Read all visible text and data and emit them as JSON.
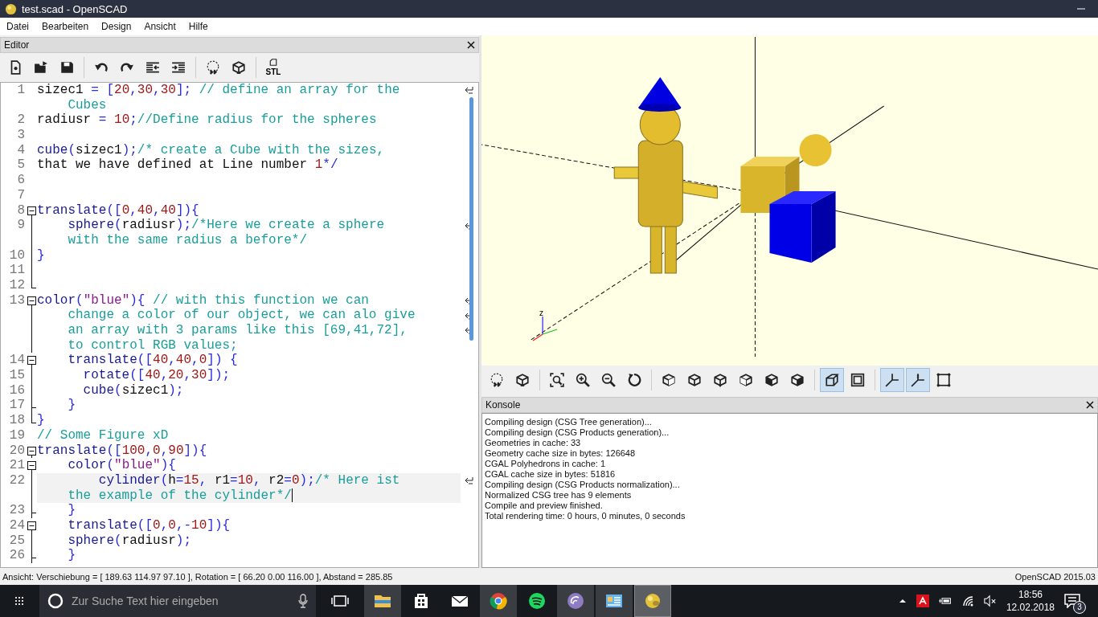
{
  "window": {
    "title": "test.scad - OpenSCAD"
  },
  "menu": [
    "Datei",
    "Bearbeiten",
    "Design",
    "Ansicht",
    "Hilfe"
  ],
  "editor": {
    "title": "Editor",
    "toolbar": [
      [
        {
          "kind": "new"
        },
        {
          "kind": "open"
        },
        {
          "kind": "save"
        }
      ],
      [
        {
          "kind": "undo"
        },
        {
          "kind": "redo"
        },
        {
          "kind": "unindent"
        },
        {
          "kind": "indent"
        }
      ],
      [
        {
          "kind": "preview"
        },
        {
          "kind": "render"
        }
      ],
      [
        {
          "kind": "stl",
          "label": "STL"
        }
      ]
    ],
    "lines": [
      {
        "number": "1",
        "kind": "plain",
        "current": false,
        "rows": [
          "sizec1 = [20,30,30]; // define an array for the",
          "    Cubes"
        ]
      },
      {
        "number": "2",
        "kind": "plain",
        "current": false,
        "rows": [
          "radiusr = 10;//Define radius for the spheres"
        ]
      },
      {
        "number": "3",
        "kind": "plain",
        "current": false
      },
      {
        "number": "4",
        "kind": "plain",
        "current": false,
        "rows": [
          "cube(sizec1);/* create a Cube with the sizes,"
        ]
      },
      {
        "number": "5",
        "kind": "plain",
        "current": false,
        "rows": [
          "that we have defined at Line number 1*/"
        ]
      },
      {
        "number": "6",
        "kind": "plain",
        "current": false
      },
      {
        "number": "7",
        "kind": "plain",
        "current": false
      },
      {
        "number": "8",
        "kind": "open",
        "current": false,
        "rows": [
          "translate([0,40,40]){"
        ]
      },
      {
        "number": "9",
        "kind": "line",
        "current": false,
        "rows": [
          "    sphere(radiusr);/*Here we create a sphere",
          "    with the same radius a before*/"
        ]
      },
      {
        "number": "10",
        "kind": "line",
        "current": false,
        "rows": [
          "}"
        ]
      },
      {
        "number": "11",
        "kind": "line",
        "current": false
      },
      {
        "number": "12",
        "kind": "end",
        "current": false
      },
      {
        "number": "13",
        "kind": "open",
        "current": false,
        "rows": [
          "color(\"blue\"){ // with this function we can",
          "    change a color of our object, we can alo give",
          "    an array with 3 params like this [69,41,72],",
          "    to control RGB values;"
        ]
      },
      {
        "number": "14",
        "kind": "open",
        "current": false,
        "rows": [
          "    translate([40,40,0]) {"
        ]
      },
      {
        "number": "15",
        "kind": "line",
        "current": false,
        "rows": [
          "      rotate([40,20,30]);"
        ]
      },
      {
        "number": "16",
        "kind": "line",
        "current": false,
        "rows": [
          "      cube(sizec1);"
        ]
      },
      {
        "number": "17",
        "kind": "tick",
        "current": false,
        "rows": [
          "    }"
        ]
      },
      {
        "number": "18",
        "kind": "end",
        "current": false,
        "rows": [
          "}"
        ]
      },
      {
        "number": "19",
        "kind": "plain",
        "current": false,
        "rows": [
          "// Some Figure xD"
        ]
      },
      {
        "number": "20",
        "kind": "open",
        "current": false,
        "rows": [
          "translate([100,0,90]){"
        ]
      },
      {
        "number": "21",
        "kind": "open",
        "current": false,
        "rows": [
          "    color(\"blue\"){"
        ]
      },
      {
        "number": "22",
        "kind": "line",
        "current": true,
        "rows": [
          "        cylinder(h=15, r1=10, r2=0);/* Here ist",
          "    the example of the cylinder*/"
        ]
      },
      {
        "number": "23",
        "kind": "tick",
        "current": false,
        "rows": [
          "    }"
        ]
      },
      {
        "number": "24",
        "kind": "open",
        "current": false,
        "rows": [
          "    translate([0,0,-10]){"
        ]
      },
      {
        "number": "25",
        "kind": "line",
        "current": false,
        "rows": [
          "    sphere(radiusr);"
        ]
      },
      {
        "number": "26",
        "kind": "tick",
        "current": false,
        "rows": [
          "    }"
        ]
      }
    ]
  },
  "viewport": {
    "axis_label": "z"
  },
  "view_toolbar": [
    [
      {
        "kind": "preview",
        "selected": false
      },
      {
        "kind": "render",
        "selected": false
      }
    ],
    [
      {
        "kind": "view-all",
        "selected": false
      },
      {
        "kind": "zoom-in",
        "selected": false
      },
      {
        "kind": "zoom-out",
        "selected": false
      },
      {
        "kind": "reset",
        "selected": false
      }
    ],
    [
      {
        "kind": "right",
        "selected": false
      },
      {
        "kind": "top",
        "selected": false
      },
      {
        "kind": "bottom",
        "selected": false
      },
      {
        "kind": "left",
        "selected": false
      },
      {
        "kind": "front",
        "selected": false
      },
      {
        "kind": "back",
        "selected": false
      }
    ],
    [
      {
        "kind": "perspective",
        "selected": true
      },
      {
        "kind": "orthogonal",
        "selected": false
      }
    ],
    [
      {
        "kind": "axes",
        "selected": true
      },
      {
        "kind": "scale",
        "selected": true
      },
      {
        "kind": "edges",
        "selected": false
      }
    ]
  ],
  "console": {
    "title": "Konsole",
    "lines": [
      "Compiling design (CSG Tree generation)...",
      "Compiling design (CSG Products generation)...",
      "Geometries in cache: 33",
      "Geometry cache size in bytes: 126648",
      "CGAL Polyhedrons in cache: 1",
      "CGAL cache size in bytes: 51816",
      "Compiling design (CSG Products normalization)...",
      "Normalized CSG tree has 9 elements",
      "Compile and preview finished.",
      "Total rendering time: 0 hours, 0 minutes, 0 seconds"
    ]
  },
  "status_bar": {
    "view": "Ansicht: Verschiebung = [ 189.63 114.97 97.10 ], Rotation = [ 66.20 0.00 116.00 ], Abstand = 285.85",
    "version": "OpenSCAD 2015.03"
  },
  "taskbar": {
    "search_placeholder": "Zur Suche Text hier eingeben",
    "apps": [
      {
        "kind": "explorer",
        "running": true,
        "selected": false
      },
      {
        "kind": "store",
        "running": false,
        "selected": false
      },
      {
        "kind": "mail",
        "running": false,
        "selected": false
      },
      {
        "kind": "chrome",
        "running": true,
        "selected": false
      },
      {
        "kind": "spotify",
        "running": false,
        "selected": false
      },
      {
        "kind": "torrent",
        "running": true,
        "selected": false
      },
      {
        "kind": "app",
        "running": true,
        "selected": false
      },
      {
        "kind": "ball",
        "running": true,
        "selected": true
      }
    ],
    "time": "18:56",
    "date": "12.02.2018",
    "notifications": "3"
  }
}
